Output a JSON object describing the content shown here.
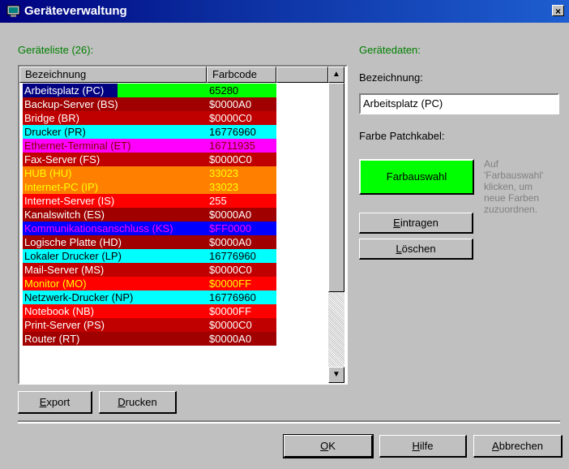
{
  "window": {
    "title": "Geräteverwaltung",
    "close_glyph": "×"
  },
  "list": {
    "label": "Geräteliste (26):",
    "columns": [
      "Bezeichnung",
      "Farbcode",
      ""
    ],
    "rows": [
      {
        "name": "Arbeitsplatz (PC)",
        "code": "65280",
        "bg": "#00ff00",
        "fg": "#000000",
        "selected": true
      },
      {
        "name": "Backup-Server (BS)",
        "code": "$0000A0",
        "bg": "#a00000",
        "fg": "#ffffff"
      },
      {
        "name": "Bridge (BR)",
        "code": "$0000C0",
        "bg": "#c00000",
        "fg": "#ffffff"
      },
      {
        "name": "Drucker (PR)",
        "code": "16776960",
        "bg": "#00ffff",
        "fg": "#000000"
      },
      {
        "name": "Ethernet-Terminal (ET)",
        "code": "16711935",
        "bg": "#ff00ff",
        "fg": "#800000"
      },
      {
        "name": "Fax-Server (FS)",
        "code": "$0000C0",
        "bg": "#c00000",
        "fg": "#ffffff"
      },
      {
        "name": "HUB (HU)",
        "code": "33023",
        "bg": "#ff8000",
        "fg": "#ffff00"
      },
      {
        "name": "Internet-PC (IP)",
        "code": "33023",
        "bg": "#ff8000",
        "fg": "#ffff00"
      },
      {
        "name": "Internet-Server (IS)",
        "code": "255",
        "bg": "#ff0000",
        "fg": "#ffffff"
      },
      {
        "name": "Kanalswitch (ES)",
        "code": "$0000A0",
        "bg": "#a00000",
        "fg": "#ffffff"
      },
      {
        "name": "Kommunikationsanschluss (KS)",
        "code": "$FF0000",
        "bg": "#0000ff",
        "fg": "#ff00ff"
      },
      {
        "name": "Logische Platte (HD)",
        "code": "$0000A0",
        "bg": "#a00000",
        "fg": "#ffffff"
      },
      {
        "name": "Lokaler Drucker (LP)",
        "code": "16776960",
        "bg": "#00ffff",
        "fg": "#000000"
      },
      {
        "name": "Mail-Server (MS)",
        "code": "$0000C0",
        "bg": "#c00000",
        "fg": "#ffffff"
      },
      {
        "name": "Monitor (MO)",
        "code": "$0000FF",
        "bg": "#ff0000",
        "fg": "#ffff00"
      },
      {
        "name": "Netzwerk-Drucker (NP)",
        "code": "16776960",
        "bg": "#00ffff",
        "fg": "#000000"
      },
      {
        "name": "Notebook (NB)",
        "code": "$0000FF",
        "bg": "#ff0000",
        "fg": "#ffffff"
      },
      {
        "name": "Print-Server (PS)",
        "code": "$0000C0",
        "bg": "#c00000",
        "fg": "#ffffff"
      },
      {
        "name": "Router (RT)",
        "code": "$0000A0",
        "bg": "#a00000",
        "fg": "#ffffff"
      }
    ]
  },
  "buttons": {
    "export": "Export",
    "print": "Drucken",
    "enter": "Eintragen",
    "delete": "Löschen",
    "ok": "OK",
    "help": "Hilfe",
    "cancel": "Abbrechen"
  },
  "details": {
    "label": "Gerätedaten:",
    "name_label": "Bezeichnung:",
    "name_value": "Arbeitsplatz (PC)",
    "color_label": "Farbe Patchkabel:",
    "color_button": "Farbauswahl",
    "color_value": "#00ff00",
    "hint": "Auf 'Farbauswahl' klicken, um neue Farben zuzuordnen."
  },
  "colors": {
    "accent_label": "#008000",
    "titlebar": "#000080"
  },
  "icons": {
    "scroll_up": "▲",
    "scroll_down": "▼"
  }
}
